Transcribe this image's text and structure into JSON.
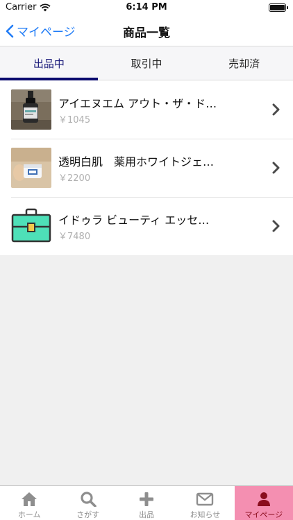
{
  "status": {
    "carrier": "Carrier",
    "time": "6:14 PM"
  },
  "nav": {
    "back_label": "マイページ",
    "title": "商品一覧"
  },
  "tabs": [
    {
      "label": "出品中",
      "active": true
    },
    {
      "label": "取引中",
      "active": false
    },
    {
      "label": "売却済",
      "active": false
    }
  ],
  "items": [
    {
      "title": "アイエヌエム アウト・ザ・ド…",
      "price": "￥1045"
    },
    {
      "title": "透明白肌　薬用ホワイトジェ…",
      "price": "￥2200"
    },
    {
      "title": "イドゥラ ビューティ エッセ…",
      "price": "￥7480"
    }
  ],
  "tab_bar": [
    {
      "label": "ホーム",
      "icon": "home-icon"
    },
    {
      "label": "さがす",
      "icon": "search-icon"
    },
    {
      "label": "出品",
      "icon": "plus-icon"
    },
    {
      "label": "お知らせ",
      "icon": "mail-icon"
    },
    {
      "label": "マイページ",
      "icon": "person-icon",
      "active": true
    }
  ],
  "colors": {
    "accent": "#1f7bf6",
    "tab_active": "#0a0a6e",
    "tabbar_active_bg": "#f48fb1",
    "tabbar_active_fg": "#8a0d1e"
  }
}
